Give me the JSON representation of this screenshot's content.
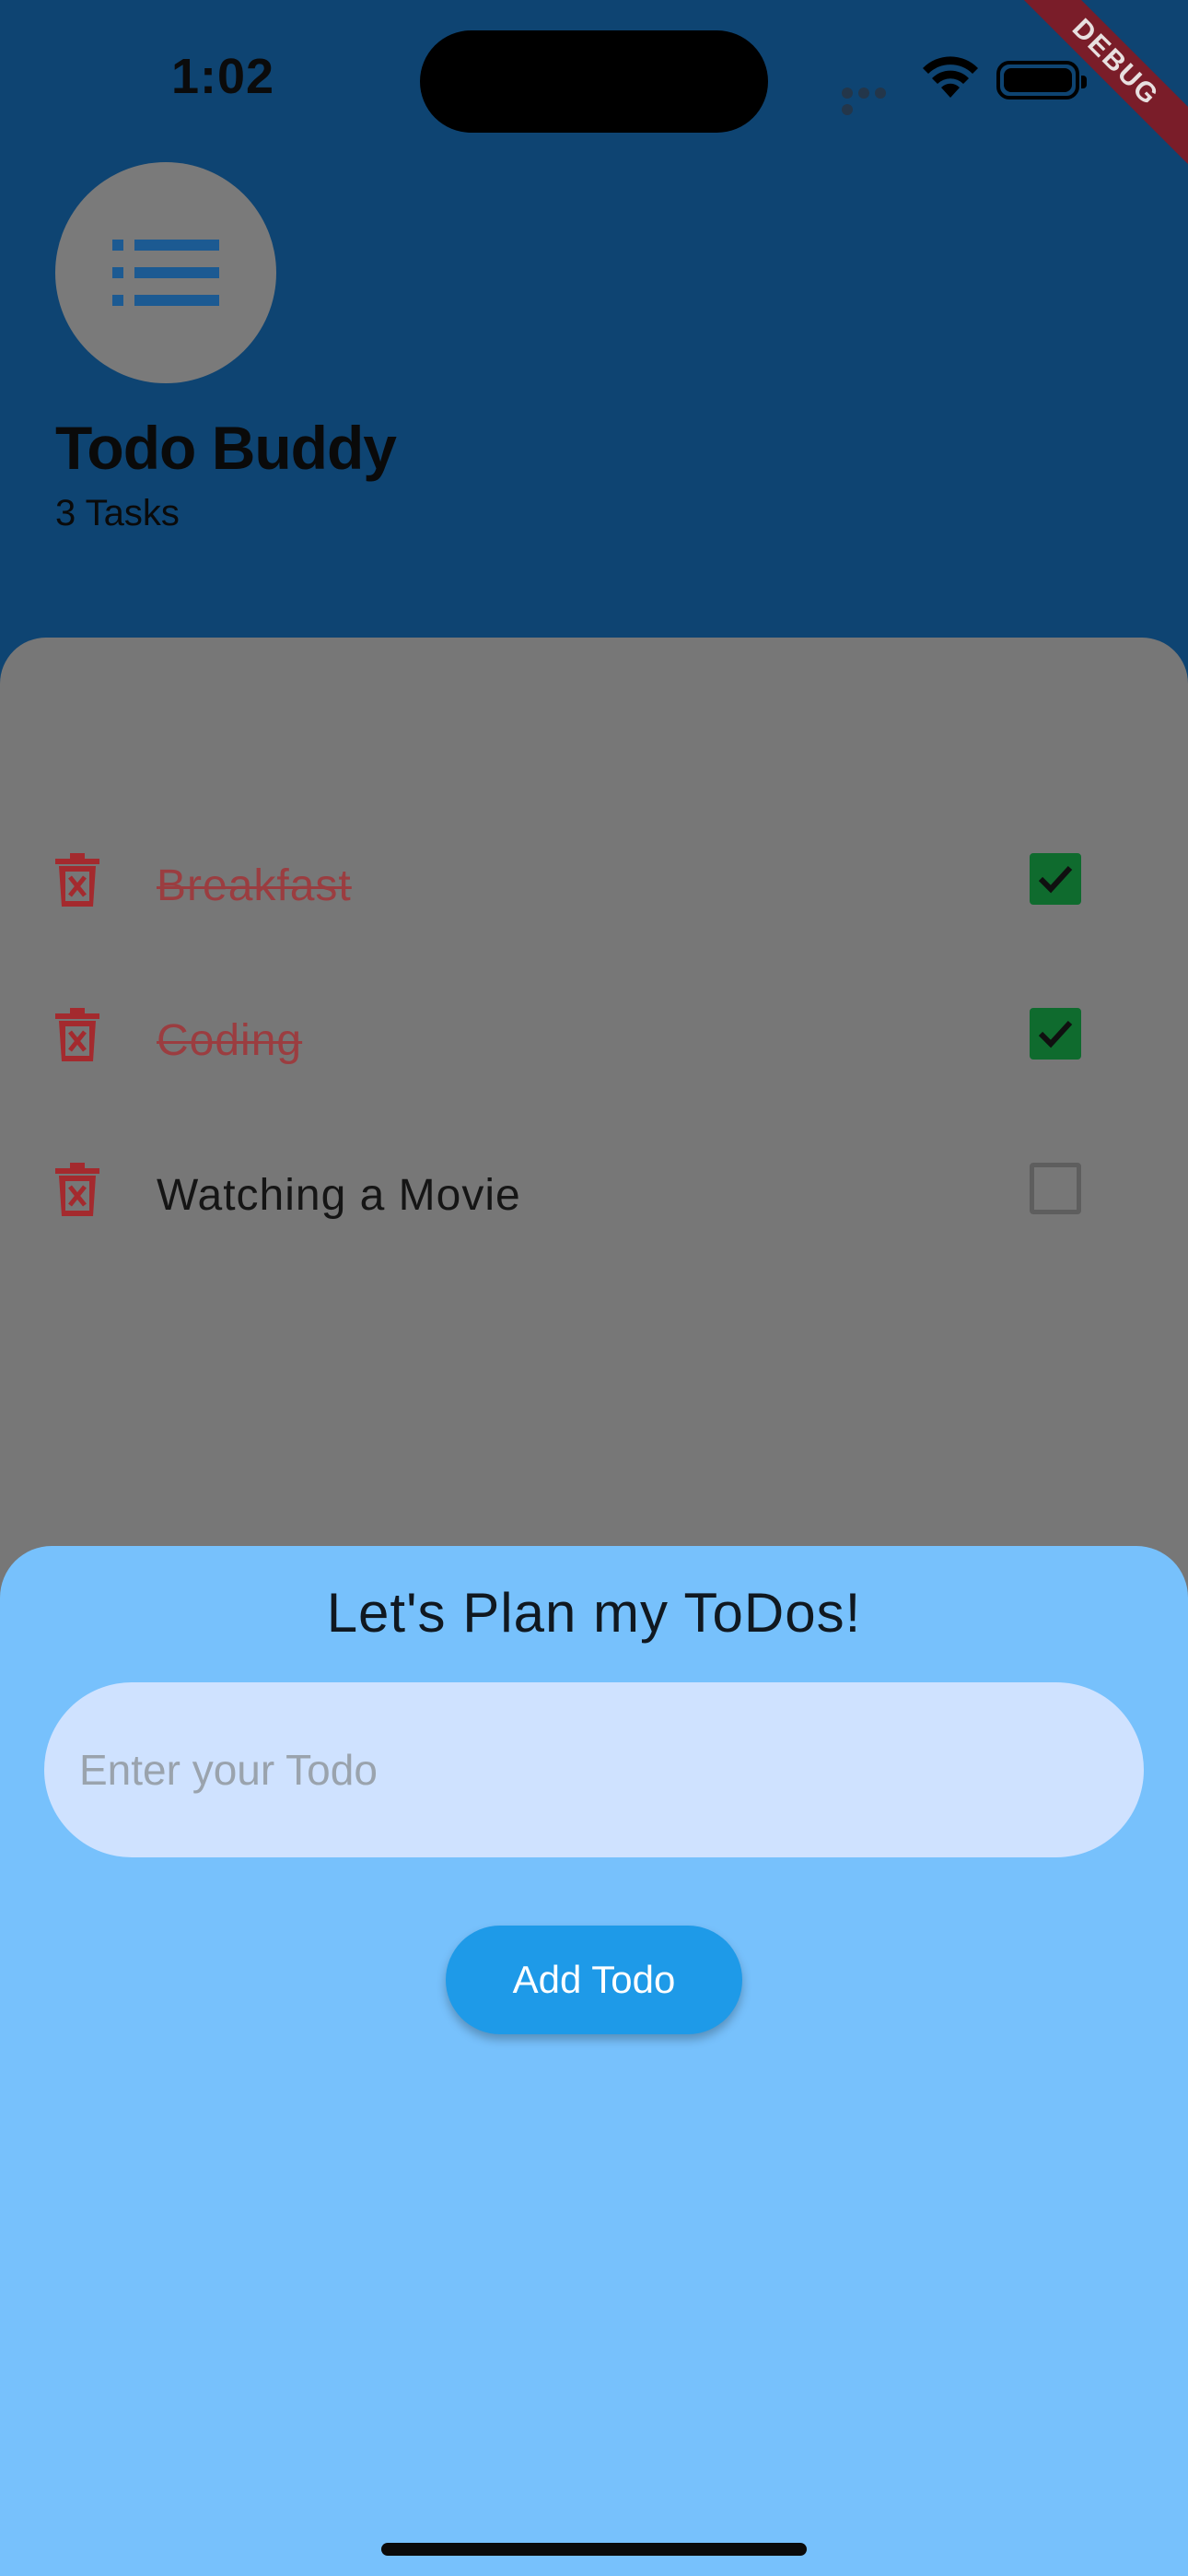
{
  "status_bar": {
    "time": "1:02"
  },
  "debug_banner": "DEBUG",
  "header": {
    "title": "Todo Buddy",
    "task_count": "3 Tasks"
  },
  "todos": [
    {
      "text": "Breakfast",
      "done": true
    },
    {
      "text": "Coding",
      "done": true
    },
    {
      "text": "Watching a Movie",
      "done": false
    }
  ],
  "sheet": {
    "title": "Let's Plan my ToDos!",
    "input_placeholder": "Enter your Todo",
    "input_value": "",
    "add_button_label": "Add Todo"
  },
  "icons": {
    "avatar": "list-icon",
    "delete": "trash-icon",
    "check": "check-icon",
    "wifi": "wifi-icon",
    "battery": "battery-icon"
  },
  "colors": {
    "header_bg": "#0E4472",
    "list_bg": "#777777",
    "sheet_bg": "#77C1FC",
    "input_bg": "#CFE2FF",
    "button_bg": "#1E9AE8",
    "done_text": "#9B3D40",
    "checkbox_on": "#0F6B2E",
    "delete_icon": "#A42A2E"
  }
}
